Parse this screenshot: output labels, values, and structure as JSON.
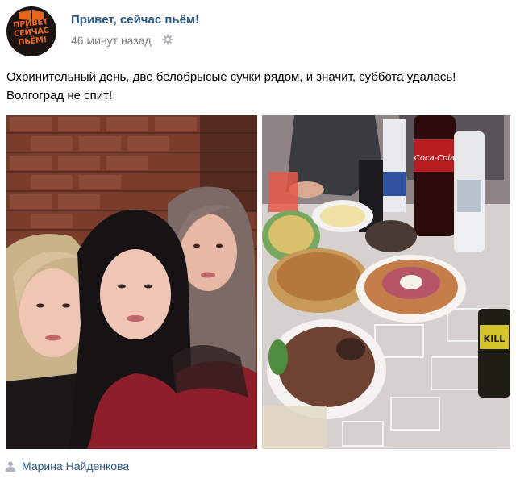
{
  "post": {
    "avatar_lines": [
      "ПРИВЕТ",
      "СЕЙЧАС",
      "ПЬЁМ!"
    ],
    "group_name": "Привет, сейчас пьём!",
    "time": "46 минут назад",
    "text_line1": "Охринительный день, две белобрысые сучки рядом, и значит, суббота удалась!",
    "text_line2": "Волгоград не спит!",
    "author": "Марина Найденкова"
  },
  "photos": {
    "right": {
      "bottle_label": "Coca-Cola",
      "can_label": "KILL"
    }
  },
  "colors": {
    "link": "#2a5885",
    "muted": "#828282",
    "avatar_text": "#e8661a"
  },
  "icons": {
    "settings": "gear-icon",
    "author": "person-icon"
  }
}
